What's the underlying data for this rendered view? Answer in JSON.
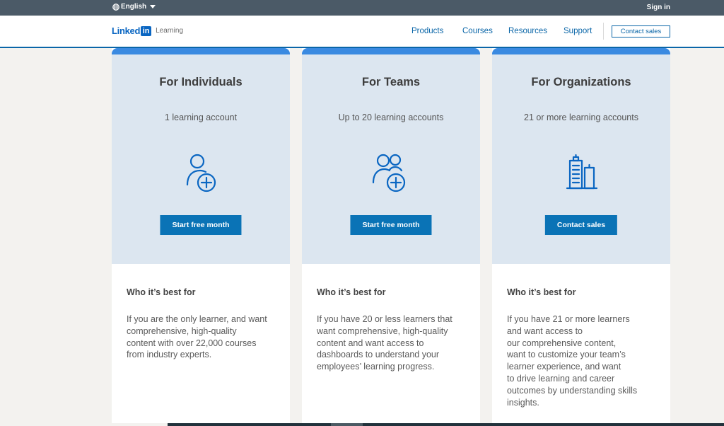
{
  "topbar": {
    "language": "English",
    "language_icon": "globe-icon",
    "sign_in": "Sign in"
  },
  "header": {
    "logo_text": "Linked",
    "logo_badge": "in",
    "logo_product": "Learning",
    "nav": [
      "Products",
      "Courses",
      "Resources",
      "Support"
    ],
    "contact_sales": "Contact sales"
  },
  "colors": {
    "topbar": "#4b5a67",
    "brand_blue": "#0a66c2",
    "card_band": "#3a8ae1",
    "card_hero": "#dce6f0",
    "cta": "#0a73b6",
    "page_bg": "#f3f2ef"
  },
  "plans": [
    {
      "title": "For Individuals",
      "subtitle": "1 learning account",
      "icon": "user-add-icon",
      "cta": "Start free month",
      "best_for_heading": "Who it’s best for",
      "best_for_text": "If you are the only learner, and want\ncomprehensive, high-quality\ncontent with over 22,000 courses\nfrom industry experts."
    },
    {
      "title": "For Teams",
      "subtitle": "Up to 20 learning accounts",
      "icon": "group-add-icon",
      "cta": "Start free month",
      "best_for_heading": "Who it’s best for",
      "best_for_text": "If you have 20 or less learners that\nwant comprehensive, high-quality\ncontent and want access to\ndashboards to understand your\nemployees’ learning progress."
    },
    {
      "title": "For Organizations",
      "subtitle": "21 or more learning accounts",
      "icon": "buildings-icon",
      "cta": "Contact sales",
      "best_for_heading": "Who it’s best for",
      "best_for_text": "If you have 21 or more learners\nand want access to\nour comprehensive content,\nwant  to customize your team’s\nlearner experience, and want\nto drive learning and career\noutcomes by understanding skills\ninsights."
    }
  ]
}
